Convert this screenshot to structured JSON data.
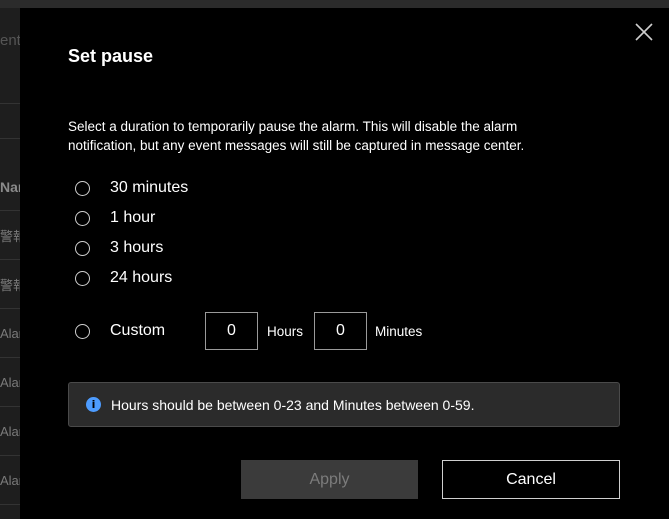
{
  "background": {
    "search_partial": "ent",
    "column_header_partial": "Nar",
    "rows": [
      "警報",
      "警報",
      "Alar",
      "Alar",
      "Alar",
      "Alar"
    ]
  },
  "dialog": {
    "title": "Set pause",
    "description": "Select a duration to temporarily pause the alarm. This will disable the alarm notification, but any event messages will still be captured in message center.",
    "options": [
      {
        "label": "30 minutes"
      },
      {
        "label": "1 hour"
      },
      {
        "label": "3 hours"
      },
      {
        "label": "24 hours"
      }
    ],
    "custom": {
      "label": "Custom",
      "hours_value": "0",
      "hours_unit": "Hours",
      "minutes_value": "0",
      "minutes_unit": "Minutes"
    },
    "info": {
      "icon": "info-icon",
      "text": "Hours should be between 0-23 and Minutes between 0-59."
    },
    "buttons": {
      "apply": "Apply",
      "cancel": "Cancel"
    },
    "colors": {
      "info_accent": "#4d9cff",
      "dialog_bg": "#000000"
    }
  }
}
